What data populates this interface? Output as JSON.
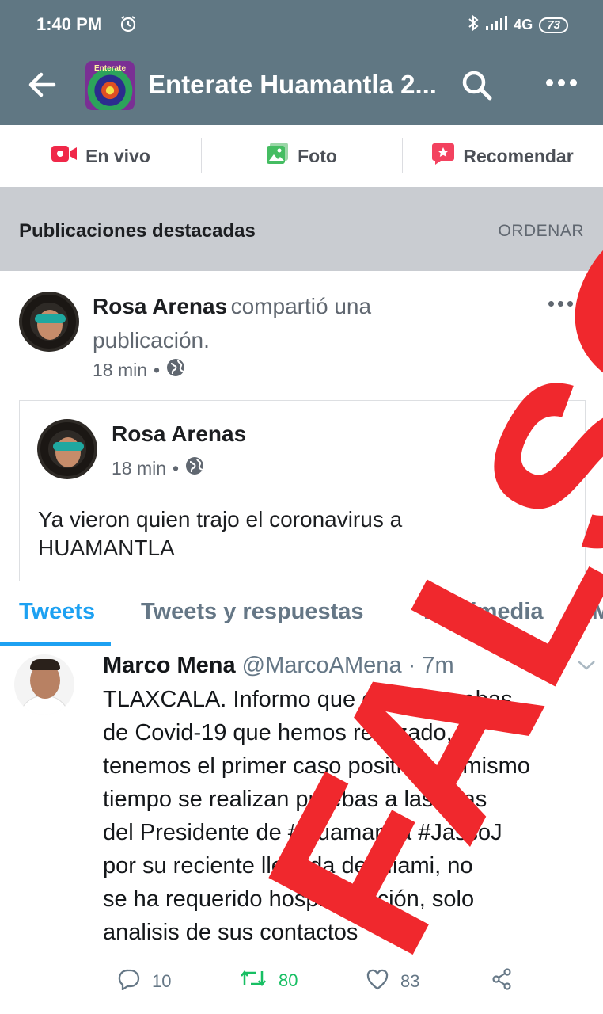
{
  "status_bar": {
    "time": "1:40 PM",
    "network": "4G",
    "battery": "73"
  },
  "header": {
    "title": "Enterate Huamantla 2...",
    "group_image_text": "Enterate"
  },
  "actions": [
    {
      "label": "En vivo",
      "icon": "live-video-icon",
      "color": "#f02849"
    },
    {
      "label": "Foto",
      "icon": "photo-icon",
      "color": "#45bd62"
    },
    {
      "label": "Recomendar",
      "icon": "recommend-icon",
      "color": "#f3425f"
    }
  ],
  "section": {
    "title": "Publicaciones destacadas",
    "sort": "ORDENAR"
  },
  "post": {
    "author": "Rosa Arenas",
    "action": "compartió una",
    "action2": "publicación.",
    "time": "18 min",
    "shared": {
      "author": "Rosa Arenas",
      "time": "18 min",
      "text_line1": "Ya vieron quien trajo el coronavirus a",
      "text_line2": "HUAMANTLA"
    }
  },
  "tweet": {
    "tabs": [
      "Tweets",
      "Tweets y respuestas",
      "Multimedia",
      "M"
    ],
    "name": "Marco Mena",
    "handle": "@MarcoAMena",
    "time": "· 7m",
    "lines": [
      "TLAXCALA. Informo que de las pruebas",
      "de Covid-19 que hemos realizado,",
      "tenemos el primer caso positivo, al mismo",
      "tiempo se realizan pruebas a las hijas",
      "del Presidente de #Huamantla #JassoJ",
      "por su reciente llegada de Miami, no",
      "se ha requerido hospitalización, solo",
      "analisis de sus contactos"
    ],
    "replies": "10",
    "retweets": "80",
    "likes": "83"
  },
  "stamp": {
    "text": "FALSO",
    "color": "#f0282d"
  }
}
